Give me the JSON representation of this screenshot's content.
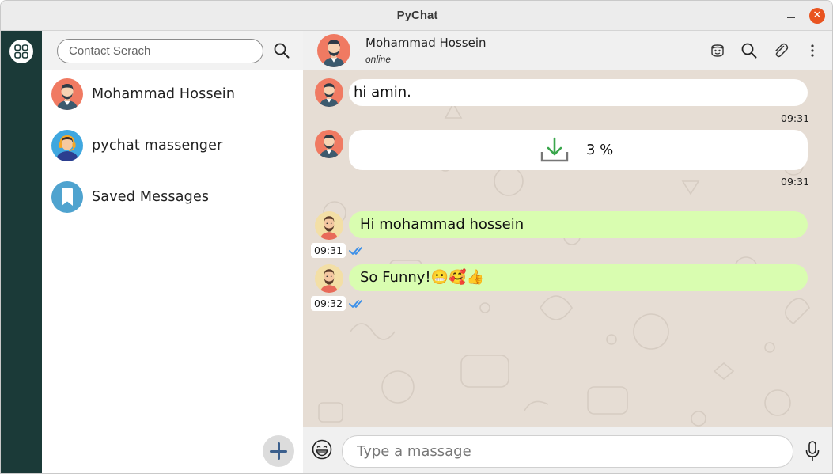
{
  "window": {
    "title": "PyChat",
    "close_glyph": "✕"
  },
  "search": {
    "placeholder": "Contact Serach"
  },
  "contacts": [
    {
      "name": "Mohammad Hossein",
      "avatar": "man-avatar-icon"
    },
    {
      "name": "pychat massenger",
      "avatar": "support-agent-icon"
    },
    {
      "name": "Saved Messages",
      "avatar": "bookmark-icon"
    }
  ],
  "chat": {
    "contact_name": "Mohammad Hossein",
    "status": "online",
    "messages": [
      {
        "direction": "in",
        "text": "hi amin.",
        "time": "09:31"
      },
      {
        "direction": "in",
        "type": "download",
        "progress_label": "3 %",
        "progress": 0.03,
        "time": "09:31"
      },
      {
        "direction": "out",
        "text": "Hi mohammad hossein",
        "time": "09:31",
        "read": true
      },
      {
        "direction": "out",
        "text": "So Funny!😬🥰👍",
        "time": "09:32",
        "read": true
      }
    ]
  },
  "composer": {
    "placeholder": "Type a massage"
  },
  "colors": {
    "rail": "#1b3a38",
    "outgoing_bubble": "#d9fdb0",
    "incoming_bubble": "#ffffff",
    "chat_background": "#e6ddd4",
    "close_button": "#e95420",
    "read_ticks": "#3b8fe8",
    "download_arrow": "#3aa64c"
  }
}
